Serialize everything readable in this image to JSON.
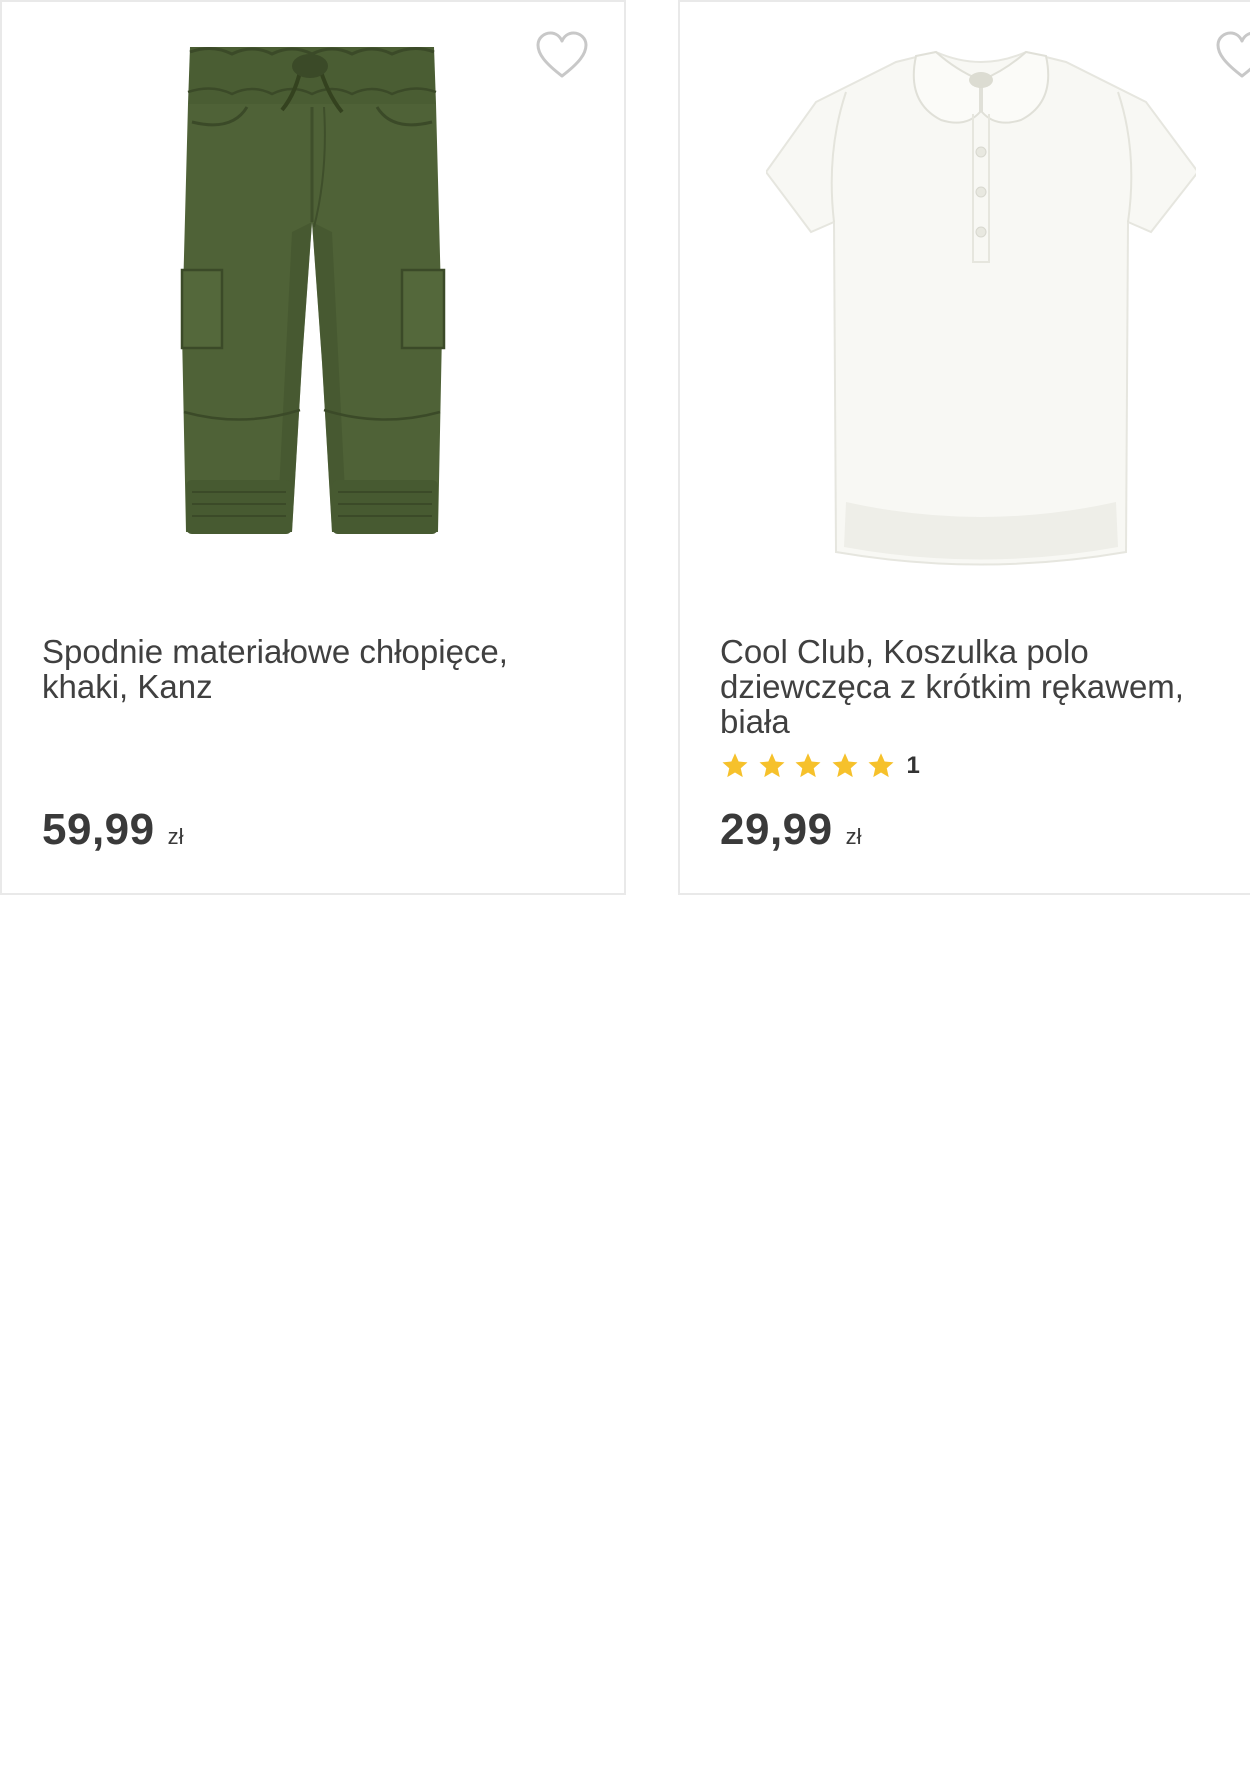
{
  "products": [
    {
      "name": "Spodnie materiałowe chłopięce, khaki, Kanz",
      "price": "59,99",
      "currency": "zł",
      "image": "khaki-cargo-jogger-pants",
      "favorite_icon": "heart-outline-icon",
      "colors": {
        "fabric": "#4f6237",
        "fabric_dark": "#3f4f2b",
        "fabric_light": "#5c7040"
      }
    },
    {
      "name": "Cool Club, Koszulka polo dziewczęca z krótkim rękawem, biała",
      "price": "29,99",
      "currency": "zł",
      "rating_count": "1",
      "rating_stars": 5,
      "image": "white-polo-shirt-peter-pan-collar",
      "favorite_icon": "heart-outline-icon",
      "colors": {
        "fabric": "#f8f8f4",
        "fabric_shadow": "#eaeae4",
        "star": "#f6c12b"
      }
    }
  ]
}
